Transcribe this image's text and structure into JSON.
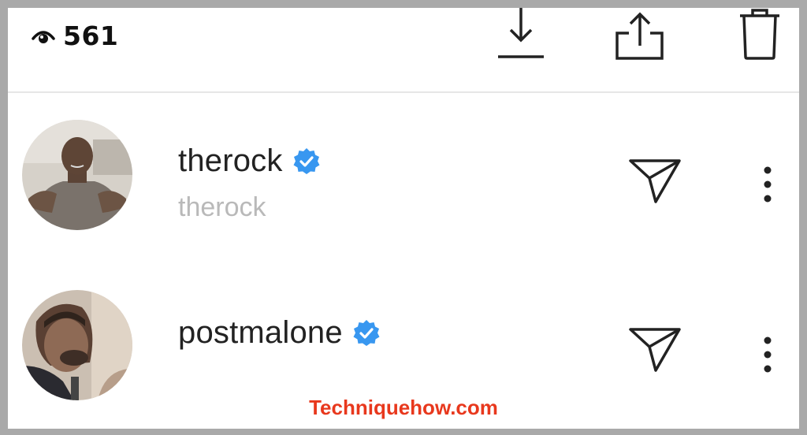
{
  "header": {
    "view_count": "561",
    "icons": [
      "eye-icon",
      "download-icon",
      "share-icon",
      "trash-icon"
    ]
  },
  "viewers": [
    {
      "username": "therock",
      "display_name": "therock",
      "verified": true
    },
    {
      "username": "postmalone",
      "display_name": "",
      "verified": true
    }
  ],
  "watermark": "Techniquehow.com",
  "colors": {
    "verified_badge": "#3897f0",
    "subtitle_text": "#b9b9b9",
    "watermark": "#e8381d"
  }
}
